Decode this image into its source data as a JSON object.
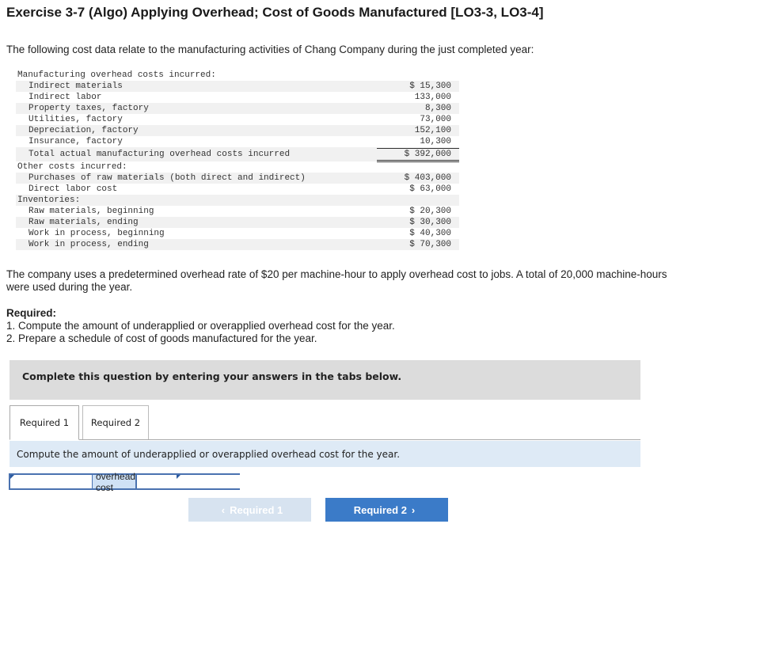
{
  "title": "Exercise 3-7 (Algo) Applying Overhead; Cost of Goods Manufactured [LO3-3, LO3-4]",
  "intro": "The following cost data relate to the manufacturing activities of Chang Company during the just completed year:",
  "table": {
    "moh_header": "Manufacturing overhead costs incurred:",
    "moh_items": [
      {
        "label": "Indirect materials",
        "value": "$ 15,300"
      },
      {
        "label": "Indirect labor",
        "value": "133,000"
      },
      {
        "label": "Property taxes, factory",
        "value": "8,300"
      },
      {
        "label": "Utilities, factory",
        "value": "73,000"
      },
      {
        "label": "Depreciation, factory",
        "value": "152,100"
      },
      {
        "label": "Insurance, factory",
        "value": "10,300"
      }
    ],
    "moh_total": {
      "label": "Total actual manufacturing overhead costs incurred",
      "value": "$ 392,000"
    },
    "other_header": "Other costs incurred:",
    "other_items": [
      {
        "label": "Purchases of raw materials (both direct and indirect)",
        "value": "$ 403,000"
      },
      {
        "label": "Direct labor cost",
        "value": "$ 63,000"
      }
    ],
    "inv_header": "Inventories:",
    "inv_items": [
      {
        "label": "Raw materials, beginning",
        "value": "$ 20,300"
      },
      {
        "label": "Raw materials, ending",
        "value": "$ 30,300"
      },
      {
        "label": "Work in process, beginning",
        "value": "$ 40,300"
      },
      {
        "label": "Work in process, ending",
        "value": "$ 70,300"
      }
    ]
  },
  "paragraph": "The company uses a predetermined overhead rate of $20 per machine-hour to apply overhead cost to jobs. A total of 20,000 machine-hours were used during the year.",
  "required": {
    "heading": "Required:",
    "line1": "1. Compute the amount of underapplied or overapplied overhead cost for the year.",
    "line2": "2. Prepare a schedule of cost of goods manufactured for the year."
  },
  "banner": "Complete this question by entering your answers in the tabs below.",
  "tabs": [
    {
      "label": "Required 1",
      "active": true
    },
    {
      "label": "Required 2",
      "active": false
    }
  ],
  "instruction": "Compute the amount of underapplied or overapplied overhead cost for the year.",
  "answer": {
    "left_value": "",
    "middle_label": "overhead cost",
    "right_value": ""
  },
  "nav": {
    "prev_label": "Required 1",
    "next_label": "Required 2",
    "prev_icon": "chevron-left-icon",
    "next_icon": "chevron-right-icon"
  },
  "colors": {
    "accent": "#3b7bc8",
    "disabled_button": "#d7e3f0",
    "instruction_bg": "#deeaf6",
    "banner_bg": "#dcdcdc"
  }
}
